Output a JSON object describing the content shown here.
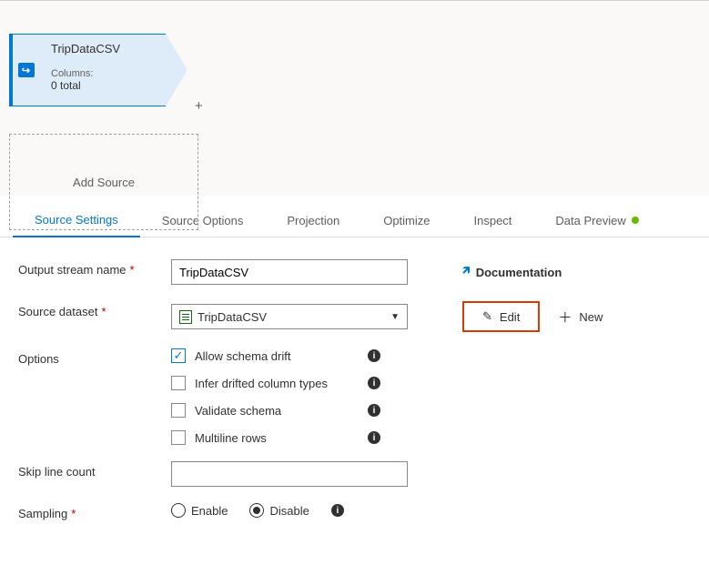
{
  "canvas": {
    "node": {
      "title": "TripDataCSV",
      "meta_label": "Columns:",
      "meta_value": "0 total"
    },
    "add_source_label": "Add Source",
    "plus": "+"
  },
  "tabs": [
    {
      "label": "Source Settings",
      "active": true
    },
    {
      "label": "Source Options"
    },
    {
      "label": "Projection"
    },
    {
      "label": "Optimize"
    },
    {
      "label": "Inspect"
    },
    {
      "label": "Data Preview",
      "dot": true
    }
  ],
  "form": {
    "output_stream": {
      "label": "Output stream name",
      "required": true,
      "value": "TripDataCSV"
    },
    "documentation": {
      "label": "Documentation"
    },
    "source_dataset": {
      "label": "Source dataset",
      "required": true,
      "value": "TripDataCSV"
    },
    "edit": {
      "label": "Edit"
    },
    "new": {
      "label": "New"
    },
    "options": {
      "label": "Options",
      "items": [
        {
          "label": "Allow schema drift",
          "checked": true
        },
        {
          "label": "Infer drifted column types",
          "checked": false
        },
        {
          "label": "Validate schema",
          "checked": false
        },
        {
          "label": "Multiline rows",
          "checked": false
        }
      ]
    },
    "skip_lines": {
      "label": "Skip line count",
      "value": ""
    },
    "sampling": {
      "label": "Sampling",
      "required": true,
      "enable": "Enable",
      "disable": "Disable",
      "selected": "disable"
    }
  }
}
